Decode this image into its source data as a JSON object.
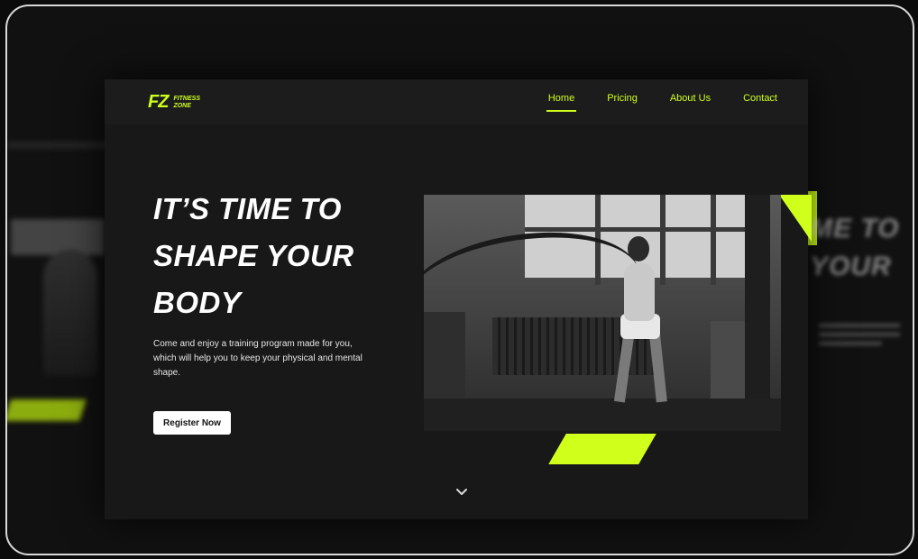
{
  "brand": {
    "mark": "FZ",
    "name_line1": "FITNESS",
    "name_line2": "ZONE",
    "accent_color": "#cfff1a"
  },
  "nav": {
    "items": [
      {
        "label": "Home",
        "active": true
      },
      {
        "label": "Pricing",
        "active": false
      },
      {
        "label": "About Us",
        "active": false
      },
      {
        "label": "Contact",
        "active": false
      }
    ]
  },
  "hero": {
    "headline_line1": "IT’S TIME TO",
    "headline_line2": "SHAPE YOUR",
    "headline_line3": "BODY",
    "description": "Come and enjoy a training program made for you, which will help you to keep your physical and mental shape.",
    "cta_label": "Register Now",
    "image_alt_icon": "battle-rope-workout-photo"
  },
  "background_copy": {
    "line1": "ME TO",
    "line2": "YOUR"
  },
  "icons": {
    "scroll": "chevron-down-icon"
  }
}
